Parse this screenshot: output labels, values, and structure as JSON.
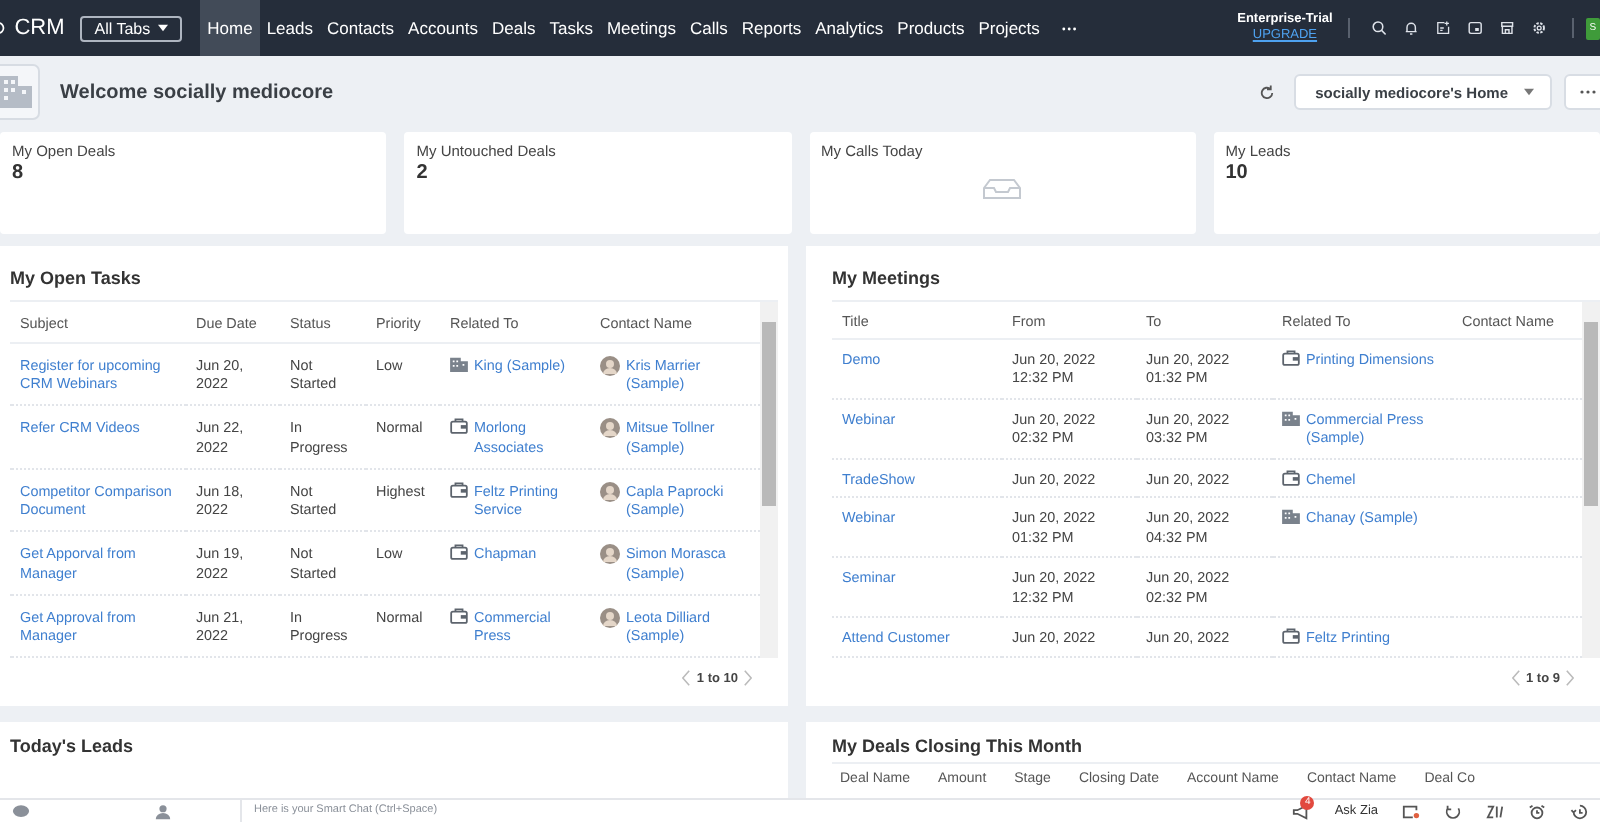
{
  "nav": {
    "brand": "CRM",
    "all_tabs": "All Tabs",
    "tabs": [
      {
        "label": "Home",
        "selected": true
      },
      {
        "label": "Leads",
        "selected": false
      },
      {
        "label": "Contacts",
        "selected": false
      },
      {
        "label": "Accounts",
        "selected": false
      },
      {
        "label": "Deals",
        "selected": false
      },
      {
        "label": "Tasks",
        "selected": false
      },
      {
        "label": "Meetings",
        "selected": false
      },
      {
        "label": "Calls",
        "selected": false
      },
      {
        "label": "Reports",
        "selected": false
      },
      {
        "label": "Analytics",
        "selected": false
      },
      {
        "label": "Products",
        "selected": false
      },
      {
        "label": "Projects",
        "selected": false
      }
    ],
    "plan": "Enterprise-Trial",
    "upgrade": "UPGRADE",
    "avatar": "S"
  },
  "welcome": {
    "title": "Welcome socially mediocore",
    "home_select": "socially mediocore's Home"
  },
  "stats": [
    {
      "kind": "count",
      "label": "My Open Deals",
      "value": "8"
    },
    {
      "kind": "count",
      "label": "My Untouched Deals",
      "value": "2"
    },
    {
      "kind": "empty",
      "label": "My Calls Today"
    },
    {
      "kind": "count",
      "label": "My Leads",
      "value": "10"
    }
  ],
  "tasks": {
    "title": "My Open Tasks",
    "columns": [
      "Subject",
      "Due Date",
      "Status",
      "Priority",
      "Related To",
      "Contact Name"
    ],
    "rows": [
      {
        "subject": "Register for upcoming CRM Webinars",
        "due": "Jun 20, 2022",
        "status": "Not Started",
        "priority": "Low",
        "related": {
          "kind": "account",
          "name": "King (Sample)"
        },
        "contact": "Kris Marrier (Sample)"
      },
      {
        "subject": "Refer CRM Videos",
        "due": "Jun 22, 2022",
        "status": "In Progress",
        "priority": "Normal",
        "related": {
          "kind": "deal",
          "name": "Morlong Associates"
        },
        "contact": "Mitsue Tollner (Sample)"
      },
      {
        "subject": "Competitor Comparison Document",
        "due": "Jun 18, 2022",
        "status": "Not Started",
        "priority": "Highest",
        "related": {
          "kind": "deal",
          "name": "Feltz Printing Service"
        },
        "contact": "Capla Paprocki (Sample)"
      },
      {
        "subject": "Get Apporval from Manager",
        "due": "Jun 19, 2022",
        "status": "Not Started",
        "priority": "Low",
        "related": {
          "kind": "deal",
          "name": "Chapman"
        },
        "contact": "Simon Morasca (Sample)"
      },
      {
        "subject": "Get Approval from Manager",
        "due": "Jun 21, 2022",
        "status": "In Progress",
        "priority": "Normal",
        "related": {
          "kind": "deal",
          "name": "Commercial Press"
        },
        "contact": "Leota Dilliard (Sample)"
      }
    ],
    "pager": "1 to 10"
  },
  "meetings": {
    "title": "My Meetings",
    "columns": [
      "Title",
      "From",
      "To",
      "Related To",
      "Contact Name"
    ],
    "rows": [
      {
        "title": "Demo",
        "from": {
          "date": "Jun 20, 2022",
          "time": "12:32 PM"
        },
        "to": {
          "date": "Jun 20, 2022",
          "time": "01:32 PM"
        },
        "related": {
          "kind": "deal",
          "name": "Printing Dimensions"
        }
      },
      {
        "title": "Webinar",
        "from": {
          "date": "Jun 20, 2022",
          "time": "02:32 PM"
        },
        "to": {
          "date": "Jun 20, 2022",
          "time": "03:32 PM"
        },
        "related": {
          "kind": "account",
          "name": "Commercial Press (Sample)"
        }
      },
      {
        "title": "TradeShow",
        "from": {
          "date": "Jun 20, 2022"
        },
        "to": {
          "date": "Jun 20, 2022"
        },
        "related": {
          "kind": "deal",
          "name": "Chemel"
        }
      },
      {
        "title": "Webinar",
        "from": {
          "date": "Jun 20, 2022",
          "time": "01:32 PM"
        },
        "to": {
          "date": "Jun 20, 2022",
          "time": "04:32 PM"
        },
        "related": {
          "kind": "account",
          "name": "Chanay (Sample)"
        }
      },
      {
        "title": "Seminar",
        "from": {
          "date": "Jun 20, 2022",
          "time": "12:32 PM"
        },
        "to": {
          "date": "Jun 20, 2022",
          "time": "02:32 PM"
        }
      },
      {
        "title": "Attend Customer",
        "from": {
          "date": "Jun 20, 2022"
        },
        "to": {
          "date": "Jun 20, 2022"
        },
        "related": {
          "kind": "deal",
          "name": "Feltz Printing"
        }
      }
    ],
    "pager": "1 to 9"
  },
  "leads": {
    "title": "Today's Leads"
  },
  "deals": {
    "title": "My Deals Closing This Month",
    "columns": [
      "Deal Name",
      "Amount",
      "Stage",
      "Closing Date",
      "Account Name",
      "Contact Name",
      "Deal Co"
    ]
  },
  "bottom": {
    "chat_placeholder": "Here is your Smart Chat (Ctrl+Space)",
    "badge": "4",
    "ask": "Ask Zia"
  }
}
